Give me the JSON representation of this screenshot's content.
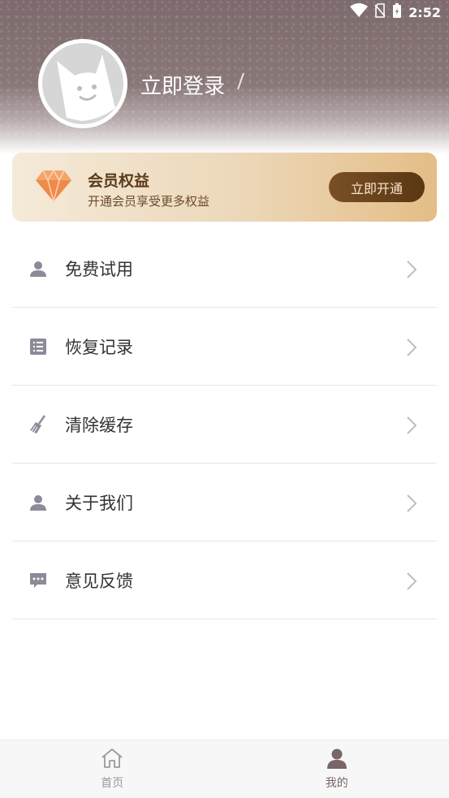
{
  "status_bar": {
    "time": "2:52"
  },
  "profile": {
    "login_text": "立即登录"
  },
  "vip": {
    "title": "会员权益",
    "subtitle": "开通会员享受更多权益",
    "button": "立即开通"
  },
  "menu": {
    "items": [
      {
        "label": "免费试用",
        "icon": "user-icon"
      },
      {
        "label": "恢复记录",
        "icon": "list-icon"
      },
      {
        "label": "清除缓存",
        "icon": "broom-icon"
      },
      {
        "label": "关于我们",
        "icon": "user-icon"
      },
      {
        "label": "意见反馈",
        "icon": "chat-icon"
      }
    ]
  },
  "tabbar": {
    "tabs": [
      {
        "label": "首页",
        "icon": "home-icon",
        "active": false
      },
      {
        "label": "我的",
        "icon": "profile-icon",
        "active": true
      }
    ]
  },
  "colors": {
    "header": "#8a7879",
    "vip_button": "#6b4419",
    "icon_gray": "#8e8a99",
    "active_tab": "#7a6668"
  }
}
